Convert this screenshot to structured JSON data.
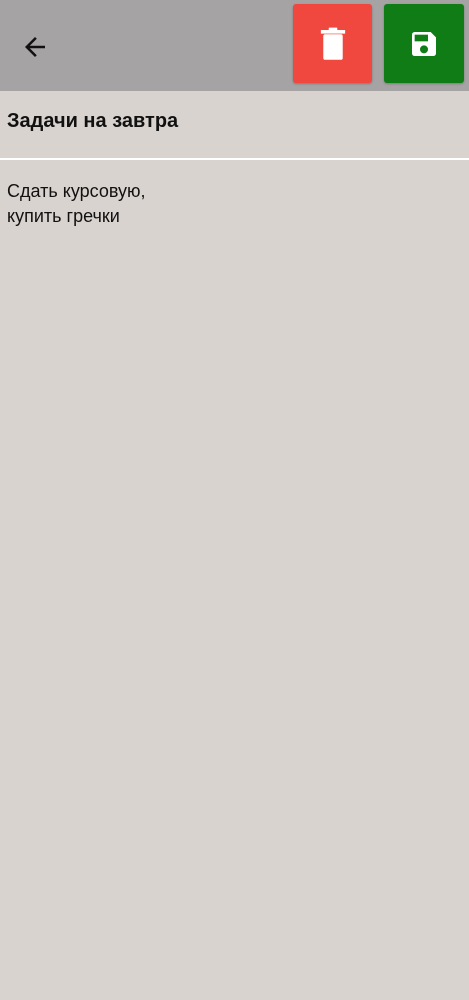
{
  "toolbar": {
    "back_icon": "arrow-left-icon",
    "delete_icon": "trash-icon",
    "save_icon": "floppy-disk-icon",
    "background_color": "#a6a3a5",
    "delete_color": "#f0483e",
    "save_color": "#0f7c16"
  },
  "note": {
    "title": "Задачи на завтра",
    "body": "Сдать курсовую,\nкупить гречки"
  },
  "colors": {
    "background": "#d9d3d0",
    "divider": "#ffffff"
  }
}
